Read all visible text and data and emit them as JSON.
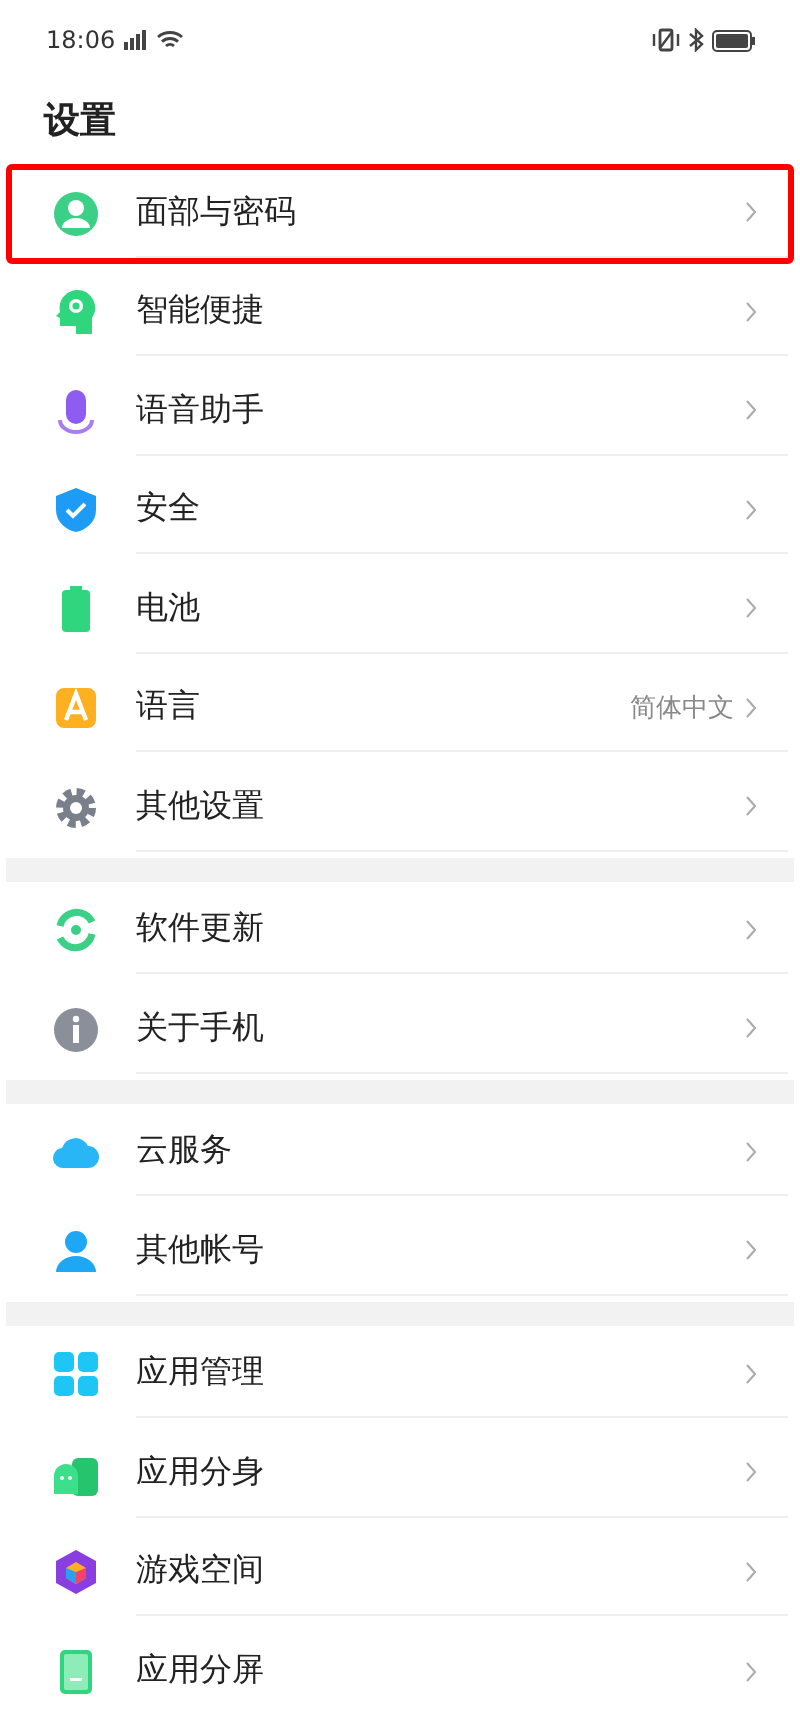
{
  "status_bar": {
    "time": "18:06"
  },
  "title": "设置",
  "groups": [
    {
      "items": [
        {
          "label": "面部与密码",
          "highlighted": true
        },
        {
          "label": "智能便捷",
          "highlighted": false
        },
        {
          "label": "语音助手",
          "highlighted": false
        },
        {
          "label": "安全",
          "highlighted": false
        },
        {
          "label": "电池",
          "highlighted": false
        },
        {
          "label": "语言",
          "value": "简体中文",
          "highlighted": false
        },
        {
          "label": "其他设置",
          "highlighted": false
        }
      ]
    },
    {
      "items": [
        {
          "label": "软件更新",
          "highlighted": false
        },
        {
          "label": "关于手机",
          "highlighted": false
        }
      ]
    },
    {
      "items": [
        {
          "label": "云服务",
          "highlighted": false
        },
        {
          "label": "其他帐号",
          "highlighted": false
        }
      ]
    },
    {
      "items": [
        {
          "label": "应用管理",
          "highlighted": false
        },
        {
          "label": "应用分身",
          "highlighted": false
        },
        {
          "label": "游戏空间",
          "highlighted": false
        },
        {
          "label": "应用分屏",
          "highlighted": false
        }
      ]
    }
  ]
}
